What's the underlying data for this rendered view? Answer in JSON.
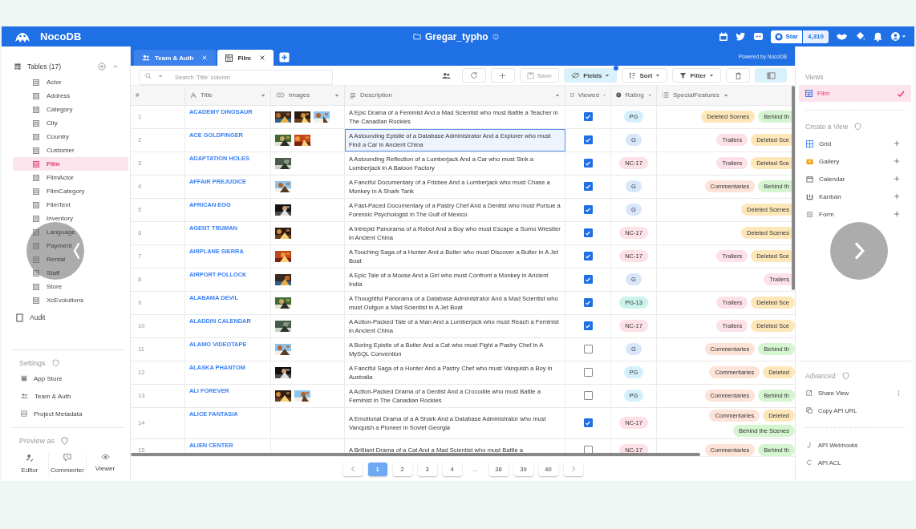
{
  "topbar": {
    "brand": "NocoDB",
    "project": "Gregar_typho",
    "star_label": "Star",
    "star_count": "4,310"
  },
  "tabs": [
    {
      "label": "Team & Auth",
      "kind": "team",
      "selected": false
    },
    {
      "label": "Film",
      "kind": "table",
      "selected": true
    }
  ],
  "powered_by": "Powered by NocoDB",
  "sidebar": {
    "tables_header": "Tables (17)",
    "tables": [
      {
        "label": "Actor",
        "selected": false
      },
      {
        "label": "Address",
        "selected": false
      },
      {
        "label": "Category",
        "selected": false
      },
      {
        "label": "City",
        "selected": false
      },
      {
        "label": "Country",
        "selected": false
      },
      {
        "label": "Customer",
        "selected": false
      },
      {
        "label": "Film",
        "selected": true
      },
      {
        "label": "FilmActor",
        "selected": false
      },
      {
        "label": "FilmCategory",
        "selected": false
      },
      {
        "label": "FilmText",
        "selected": false
      },
      {
        "label": "Inventory",
        "selected": false
      },
      {
        "label": "Language",
        "selected": false
      },
      {
        "label": "Payment",
        "selected": false
      },
      {
        "label": "Rental",
        "selected": false
      },
      {
        "label": "Staff",
        "selected": false
      },
      {
        "label": "Store",
        "selected": false
      },
      {
        "label": "XcEvolutions",
        "selected": false
      }
    ],
    "audit": "Audit",
    "settings_title": "Settings",
    "settings": [
      {
        "label": "App Store",
        "kind": "store"
      },
      {
        "label": "Team & Auth",
        "kind": "team"
      },
      {
        "label": "Project Metadata",
        "kind": "meta"
      }
    ],
    "preview_title": "Preview as",
    "roles": [
      {
        "label": "Editor",
        "kind": "editor"
      },
      {
        "label": "Commenter",
        "kind": "commenter"
      },
      {
        "label": "Viewer",
        "kind": "viewer"
      }
    ]
  },
  "toolbar": {
    "search_placeholder": "Search 'Title' column",
    "save": "Save",
    "save_disabled": true,
    "fields": "Fields",
    "fields_active": true,
    "sort": "Sort",
    "filter": "Filter"
  },
  "table": {
    "columns": [
      {
        "label": "#",
        "kind": "index"
      },
      {
        "label": "Title",
        "kind": "title"
      },
      {
        "label": "Images",
        "kind": "attachment"
      },
      {
        "label": "Description",
        "kind": "longtext"
      },
      {
        "label": "Viewed",
        "kind": "checkbox"
      },
      {
        "label": "Rating",
        "kind": "select"
      },
      {
        "label": "SpecialFeatures",
        "kind": "multiselect"
      }
    ],
    "rows": [
      {
        "index": "1",
        "title": "ACADEMY DINOSAUR",
        "images": [
          {
            "kind": "picture"
          },
          {
            "kind": "picture"
          },
          {
            "kind": "picture"
          }
        ],
        "description": "A Epic Drama of a Feminist And a Mad Scientist who must Battle a Teacher in The Canadian Rockies",
        "selected": false,
        "viewed": true,
        "rating": {
          "label": "PG",
          "color": "#d3f0fd"
        },
        "features": [
          {
            "label": "Deleted Scenes",
            "color": "#fde7b9"
          },
          {
            "label": "Behind th",
            "color": "#d5f5d0"
          }
        ]
      },
      {
        "index": "2",
        "title": "ACE GOLDFINGER",
        "images": [
          {
            "kind": "picture"
          },
          {
            "kind": "picture"
          }
        ],
        "description": "A Astounding Epistle of a Database Administrator And a Explorer who must Find a Car in Ancient China",
        "selected": true,
        "viewed": true,
        "rating": {
          "label": "G",
          "color": "#d8e6fb"
        },
        "features": [
          {
            "label": "Trailers",
            "color": "#fde1e8"
          },
          {
            "label": "Deleted Sce",
            "color": "#fde7b9"
          }
        ]
      },
      {
        "index": "3",
        "title": "ADAPTATION HOLES",
        "images": [
          {
            "kind": "picture"
          }
        ],
        "description": "A Astounding Reflection of a Lumberjack And a Car who must Sink a Lumberjack in A Baloon Factory",
        "selected": false,
        "viewed": true,
        "rating": {
          "label": "NC-17",
          "color": "#fde1e6"
        },
        "features": [
          {
            "label": "Trailers",
            "color": "#fde1e8"
          },
          {
            "label": "Deleted Sce",
            "color": "#fde7b9"
          }
        ]
      },
      {
        "index": "4",
        "title": "AFFAIR PREJUDICE",
        "images": [
          {
            "kind": "picture"
          }
        ],
        "description": "A Fanciful Documentary of a Frisbee And a Lumberjack who must Chase a Monkey in A Shark Tank",
        "selected": false,
        "viewed": true,
        "rating": {
          "label": "G",
          "color": "#d8e6fb"
        },
        "features": [
          {
            "label": "Commentaries",
            "color": "#fde2d8"
          },
          {
            "label": "Behind th",
            "color": "#d5f5d0"
          }
        ]
      },
      {
        "index": "5",
        "title": "AFRICAN EGG",
        "images": [
          {
            "kind": "picture"
          }
        ],
        "description": "A Fast-Paced Documentary of a Pastry Chef And a Dentist who must Pursue a Forensic Psychologist in The Gulf of Mexico",
        "selected": false,
        "viewed": true,
        "rating": {
          "label": "G",
          "color": "#d8e6fb"
        },
        "features": [
          {
            "label": "Deleted Scenes",
            "color": "#fde7b9"
          }
        ]
      },
      {
        "index": "6",
        "title": "AGENT TRUMAN",
        "images": [
          {
            "kind": "picture"
          }
        ],
        "description": "A Intrepid Panorama of a Robot And a Boy who must Escape a Sumo Wrestler in Ancient China",
        "selected": false,
        "viewed": true,
        "rating": {
          "label": "NC-17",
          "color": "#fde1e6"
        },
        "features": [
          {
            "label": "Deleted Scenes",
            "color": "#fde7b9"
          }
        ]
      },
      {
        "index": "7",
        "title": "AIRPLANE SIERRA",
        "images": [
          {
            "kind": "picture"
          }
        ],
        "description": "A Touching Saga of a Hunter And a Butler who must Discover a Butler in A Jet Boat",
        "selected": false,
        "viewed": true,
        "rating": {
          "label": "NC-17",
          "color": "#fde1e6"
        },
        "features": [
          {
            "label": "Trailers",
            "color": "#fde1e8"
          },
          {
            "label": "Deleted Sce",
            "color": "#fde7b9"
          }
        ]
      },
      {
        "index": "8",
        "title": "AIRPORT POLLOCK",
        "images": [
          {
            "kind": "picture"
          }
        ],
        "description": "A Epic Tale of a Moose And a Girl who must Confront a Monkey in Ancient India",
        "selected": false,
        "viewed": true,
        "rating": {
          "label": "G",
          "color": "#d8e6fb"
        },
        "features": [
          {
            "label": "Trailers",
            "color": "#fde1e8"
          }
        ]
      },
      {
        "index": "9",
        "title": "ALABAMA DEVIL",
        "images": [
          {
            "kind": "picture"
          }
        ],
        "description": "A Thoughtful Panorama of a Database Administrator And a Mad Scientist who must Outgun a Mad Scientist in A Jet Boat",
        "selected": false,
        "viewed": true,
        "rating": {
          "label": "PG-13",
          "color": "#c9f3eb"
        },
        "features": [
          {
            "label": "Trailers",
            "color": "#fde1e8"
          },
          {
            "label": "Deleted Sce",
            "color": "#fde7b9"
          }
        ]
      },
      {
        "index": "10",
        "title": "ALADDIN CALENDAR",
        "images": [
          {
            "kind": "picture"
          }
        ],
        "description": "A Action-Packed Tale of a Man And a Lumberjack who must Reach a Feminist in Ancient China",
        "selected": false,
        "viewed": true,
        "rating": {
          "label": "NC-17",
          "color": "#fde1e6"
        },
        "features": [
          {
            "label": "Trailers",
            "color": "#fde1e8"
          },
          {
            "label": "Deleted Sce",
            "color": "#fde7b9"
          }
        ]
      },
      {
        "index": "11",
        "title": "ALAMO VIDEOTAPE",
        "images": [
          {
            "kind": "picture"
          }
        ],
        "description": "A Boring Epistle of a Butler And a Cat who must Fight a Pastry Chef in A MySQL Convention",
        "selected": false,
        "viewed": false,
        "rating": {
          "label": "G",
          "color": "#d8e6fb"
        },
        "features": [
          {
            "label": "Commentaries",
            "color": "#fde2d8"
          },
          {
            "label": "Behind th",
            "color": "#d5f5d0"
          }
        ]
      },
      {
        "index": "12",
        "title": "ALASKA PHANTOM",
        "images": [
          {
            "kind": "picture"
          }
        ],
        "description": "A Fanciful Saga of a Hunter And a Pastry Chef who must Vanquish a Boy in Australia",
        "selected": false,
        "viewed": false,
        "rating": {
          "label": "PG",
          "color": "#d3f0fd"
        },
        "features": [
          {
            "label": "Commentaries",
            "color": "#fde2d8"
          },
          {
            "label": "Deleted",
            "color": "#fde7b9"
          }
        ]
      },
      {
        "index": "13",
        "title": "ALI FOREVER",
        "images": [
          {
            "kind": "picture"
          },
          {
            "kind": "picture"
          }
        ],
        "description": "A Action-Packed Drama of a Dentist And a Crocodile who must Battle a Feminist in The Canadian Rockies",
        "selected": false,
        "viewed": false,
        "rating": {
          "label": "PG",
          "color": "#d3f0fd"
        },
        "features": [
          {
            "label": "Commentaries",
            "color": "#fde2d8"
          },
          {
            "label": "Behind th",
            "color": "#d5f5d0"
          }
        ]
      },
      {
        "index": "14",
        "title": "ALICE FANTASIA",
        "images": [],
        "description": "A Emotional Drama of a A Shark And a Database Administrator who must Vanquish a Pioneer in Soviet Georgia",
        "selected": false,
        "viewed": true,
        "rating": {
          "label": "NC-17",
          "color": "#fde1e6"
        },
        "features": [
          {
            "label": "Commentaries",
            "color": "#fde2d8"
          },
          {
            "label": "Deleted",
            "color": "#fde7b9"
          },
          {
            "label": "Behind the Scenes",
            "color": "#d5f5d0"
          }
        ]
      },
      {
        "index": "15",
        "title": "ALIEN CENTER",
        "images": [],
        "description": "A Brilliant Drama of a Cat And a Mad Scientist who must Battle a",
        "selected": false,
        "viewed": false,
        "rating": {
          "label": "NC-17",
          "color": "#fde1e6"
        },
        "features": [
          {
            "label": "Commentaries",
            "color": "#fde2d8"
          },
          {
            "label": "Behind th",
            "color": "#d5f5d0"
          }
        ]
      }
    ]
  },
  "pagination": [
    {
      "label": "1",
      "kind": "page",
      "selected": true
    },
    {
      "label": "2",
      "kind": "page",
      "selected": false
    },
    {
      "label": "3",
      "kind": "page",
      "selected": false
    },
    {
      "label": "4",
      "kind": "page",
      "selected": false
    },
    {
      "label": "...",
      "kind": "ellipsis"
    },
    {
      "label": "38",
      "kind": "page",
      "selected": false
    },
    {
      "label": "39",
      "kind": "page",
      "selected": false
    },
    {
      "label": "40",
      "kind": "page",
      "selected": false
    }
  ],
  "views_panel": {
    "views_title": "Views",
    "views": [
      {
        "label": "Film",
        "selected": true
      }
    ],
    "create_title": "Create a View",
    "create": [
      {
        "label": "Grid",
        "kind": "grid"
      },
      {
        "label": "Gallery",
        "kind": "gallery"
      },
      {
        "label": "Calendar",
        "kind": "calendar"
      },
      {
        "label": "Kanban",
        "kind": "kanban"
      },
      {
        "label": "Form",
        "kind": "form"
      }
    ],
    "advanced_title": "Advanced",
    "advanced": [
      {
        "label": "Share View",
        "kind": "share"
      },
      {
        "label": "Copy API URL",
        "kind": "copy"
      },
      {
        "label": "API Webhooks",
        "kind": "webhook"
      },
      {
        "label": "API ACL",
        "kind": "acl"
      }
    ]
  }
}
